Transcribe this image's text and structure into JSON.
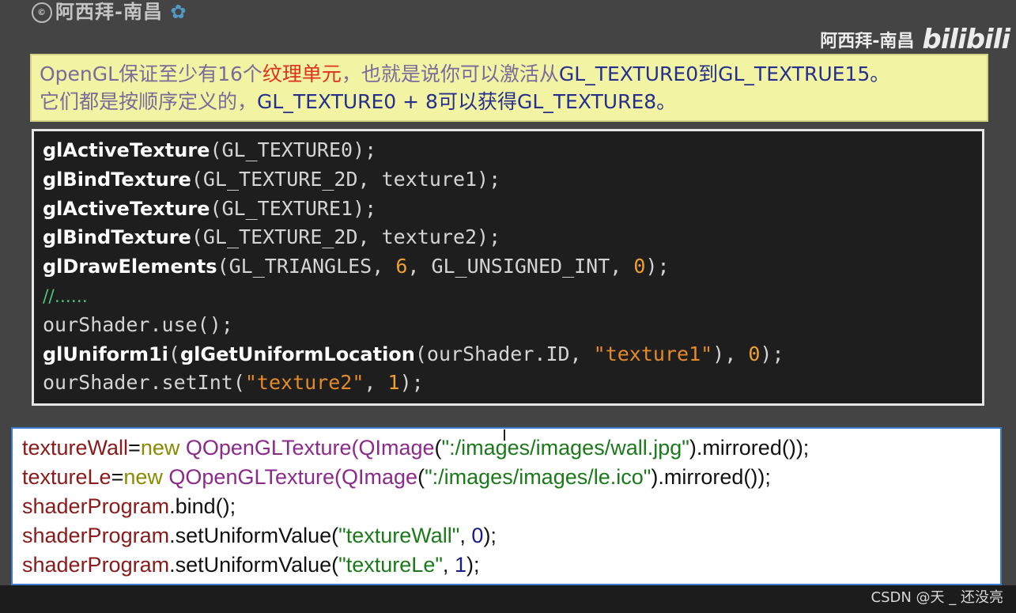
{
  "header": {
    "logo_text": "阿西拜-南昌",
    "logo_mark": "bilibili",
    "author": "阿西拜-南昌",
    "bili": "bilibili"
  },
  "note": {
    "line1_a": "OpenGL保证至少有16个",
    "line1_b": "纹理单元",
    "line1_c": "，也就是说你可以激活从",
    "line1_d": "GL_TEXTURE0到GL_TEXTRUE15。",
    "line2_a": "它们都是按顺序定义的，",
    "line2_b": "GL_TEXTURE0 + 8可以获得GL_TEXTURE8。"
  },
  "dark_code": [
    {
      "fn": "glActiveTexture",
      "args": "(GL_TEXTURE0);"
    },
    {
      "fn": "glBindTexture",
      "args": "(GL_TEXTURE_2D, texture1);"
    },
    {
      "fn": "glActiveTexture",
      "args": "(GL_TEXTURE1);"
    },
    {
      "fn": "glBindTexture",
      "args": "(GL_TEXTURE_2D, texture2);"
    },
    {
      "fn": "glDrawElements",
      "a1": "(GL_TRIANGLES, ",
      "n1": "6",
      "a2": ", GL_UNSIGNED_INT, ",
      "n2": "0",
      "a3": ");"
    },
    {
      "comment": "//......"
    },
    {
      "plain": "ourShader.use();"
    },
    {
      "fn": "glUniform1i",
      "a1": "(",
      "fn2": "glGetUniformLocation",
      "a2": "(ourShader.ID, ",
      "s1": "\"texture1\"",
      "a3": "), ",
      "n1": "0",
      "a4": ");"
    },
    {
      "a1": "ourShader.setInt(",
      "s1": "\"texture2\"",
      "a2": ", ",
      "n1": "1",
      "a3": ");"
    }
  ],
  "light_code": {
    "l1": {
      "var": "textureWall",
      "eq": "=",
      "kw": "new ",
      "cls": "QOpenGLTexture",
      "p1": "(",
      "cls2": "QImage",
      "p2": "(",
      "str": "\":/images/images/wall.jpg\"",
      "rest": ").mirrored());"
    },
    "l2": {
      "var": "textureLe",
      "eq": "=",
      "kw": "new ",
      "cls": "QOpenGLTexture",
      "p1": "(",
      "cls2": "QImage",
      "p2": "(",
      "str": "\":/images/images/le.ico\"",
      "rest": ").mirrored());"
    },
    "l3": {
      "var": "shaderProgram",
      "rest": ".bind();"
    },
    "l4": {
      "var": "shaderProgram",
      "p1": ".setUniformValue(",
      "str": "\"textureWall\"",
      "p2": ", ",
      "num": "0",
      "rest": ");"
    },
    "l5": {
      "var": "shaderProgram",
      "p1": ".setUniformValue(",
      "str": "\"textureLe\"",
      "p2": ", ",
      "num": "1",
      "rest": ");"
    }
  },
  "watermark": "CSDN @天 _ 还没亮",
  "colors": {
    "note_bg": "#f2f3a3",
    "dark_bg": "#1e1e1e",
    "light_border": "#3a7ad0",
    "highlight_red": "#e0301e"
  }
}
